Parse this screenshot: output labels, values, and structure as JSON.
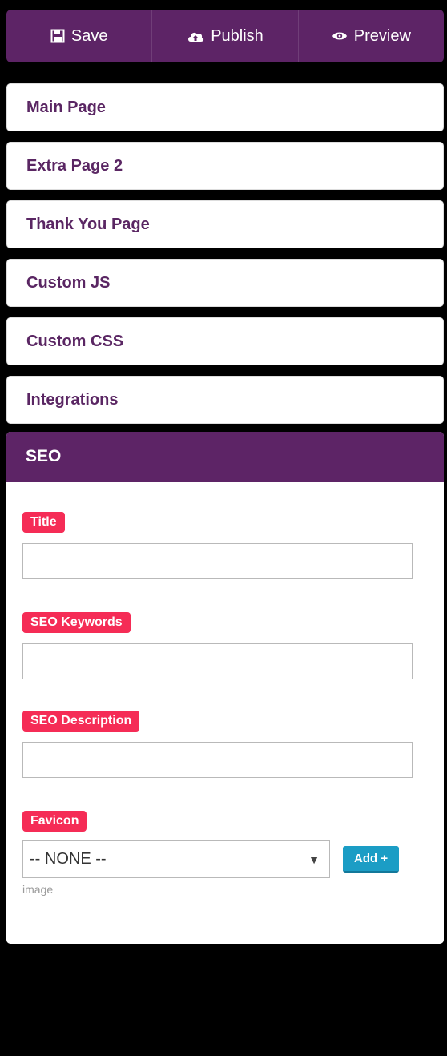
{
  "toolbar": {
    "save_label": "Save",
    "publish_label": "Publish",
    "preview_label": "Preview"
  },
  "nav": {
    "items": [
      "Main Page",
      "Extra Page 2",
      "Thank You Page",
      "Custom JS",
      "Custom CSS",
      "Integrations"
    ]
  },
  "seo": {
    "header": "SEO",
    "fields": {
      "title_label": "Title",
      "title_value": "",
      "keywords_label": "SEO Keywords",
      "keywords_value": "",
      "description_label": "SEO Description",
      "description_value": "",
      "favicon_label": "Favicon",
      "favicon_selected": "-- NONE --",
      "add_button": "Add +",
      "hint": "image"
    }
  },
  "colors": {
    "brand": "#5d2466",
    "label": "#f52c56",
    "add_button": "#1b9dc5",
    "background": "#000000"
  },
  "icons": {
    "save": "floppy-disk-icon",
    "publish": "cloud-upload-icon",
    "preview": "eye-icon",
    "dropdown": "caret-down-icon"
  }
}
